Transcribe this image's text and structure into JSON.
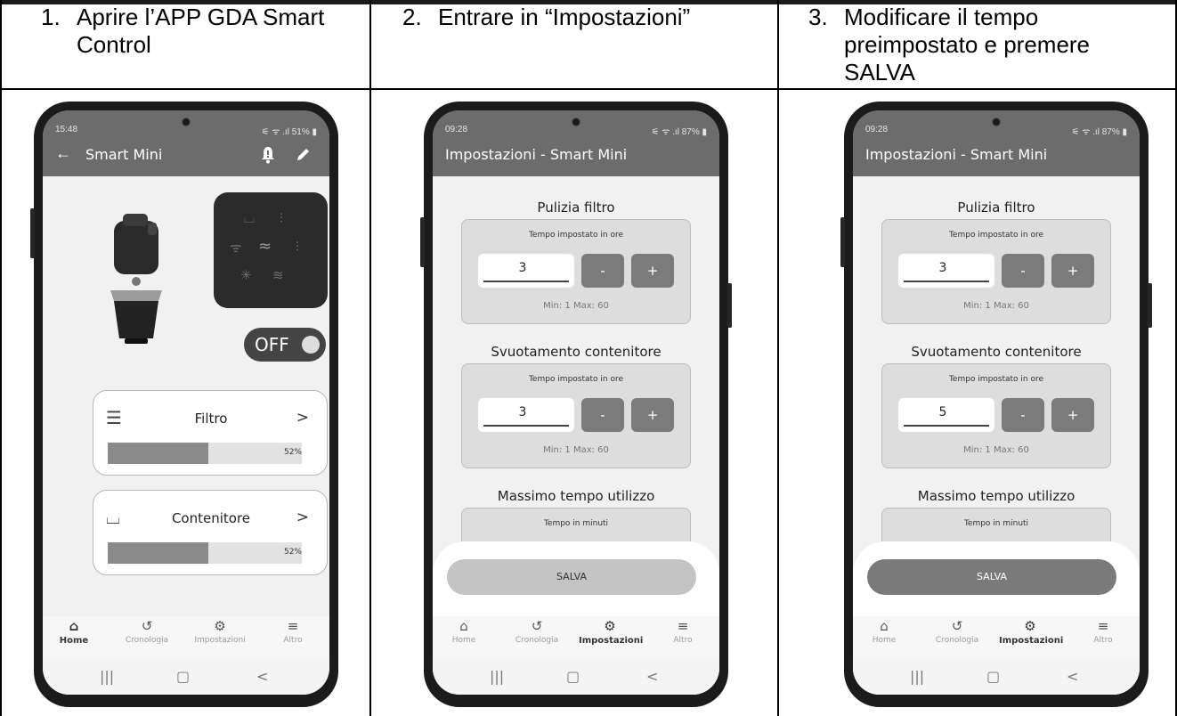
{
  "steps": [
    {
      "num": "1.",
      "line1": "Aprire l’APP GDA Smart",
      "line2": "Control",
      "line3": ""
    },
    {
      "num": "2.",
      "line1": "Entrare in “Impostazioni”",
      "line2": "",
      "line3": ""
    },
    {
      "num": "3.",
      "line1": "Modificare il tempo",
      "line2": "preimpostato e premere",
      "line3": "SALVA"
    }
  ],
  "phone1": {
    "time": "15:48",
    "status_right": "⚟ ᯤ .ıl 51% ▮",
    "title": "Smart Mini",
    "toggle_label": "OFF",
    "cards": [
      {
        "icon": "filter-icon",
        "glyph": "⫶⫶",
        "label": "Filtro",
        "percent_label": "52%",
        "percent": 52
      },
      {
        "icon": "container-icon",
        "glyph": "⌴",
        "label": "Contenitore",
        "percent_label": "52%",
        "percent": 52
      }
    ],
    "nav": {
      "home": "Home",
      "history": "Cronologia",
      "settings": "Impostazioni",
      "more": "Altro",
      "active": "home"
    }
  },
  "phone2": {
    "time": "09:28",
    "status_right": "⚟ ᯤ .ıl 87% ▮",
    "title": "Impostazioni - Smart Mini",
    "sections": [
      {
        "title": "Pulizia filtro",
        "caption": "Tempo impostato in ore",
        "value": "3",
        "minus": "-",
        "plus": "+",
        "range": "Min: 1 Max: 60"
      },
      {
        "title": "Svuotamento contenitore",
        "caption": "Tempo impostato in ore",
        "value": "3",
        "minus": "-",
        "plus": "+",
        "range": "Min: 1 Max: 60"
      },
      {
        "title": "Massimo tempo utilizzo",
        "caption": "Tempo in minuti"
      }
    ],
    "save_label": "SALVA",
    "save_enabled": false,
    "nav": {
      "home": "Home",
      "history": "Cronologia",
      "settings": "Impostazioni",
      "more": "Altro",
      "active": "settings"
    }
  },
  "phone3": {
    "time": "09:28",
    "status_right": "⚟ ᯤ .ıl 87% ▮",
    "title": "Impostazioni - Smart Mini",
    "sections": [
      {
        "title": "Pulizia filtro",
        "caption": "Tempo impostato in ore",
        "value": "3",
        "minus": "-",
        "plus": "+",
        "range": "Min: 1 Max: 60"
      },
      {
        "title": "Svuotamento contenitore",
        "caption": "Tempo impostato in ore",
        "value": "5",
        "minus": "-",
        "plus": "+",
        "range": "Min: 1 Max: 60"
      },
      {
        "title": "Massimo tempo utilizzo",
        "caption": "Tempo in minuti"
      }
    ],
    "save_label": "SALVA",
    "save_enabled": true,
    "nav": {
      "home": "Home",
      "history": "Cronologia",
      "settings": "Impostazioni",
      "more": "Altro",
      "active": "settings"
    }
  },
  "colors": {
    "appbar": "#6c6c6c",
    "save_enabled": "#7a7a7a",
    "save_disabled": "#c4c4c4",
    "button": "#7b7b7b"
  }
}
